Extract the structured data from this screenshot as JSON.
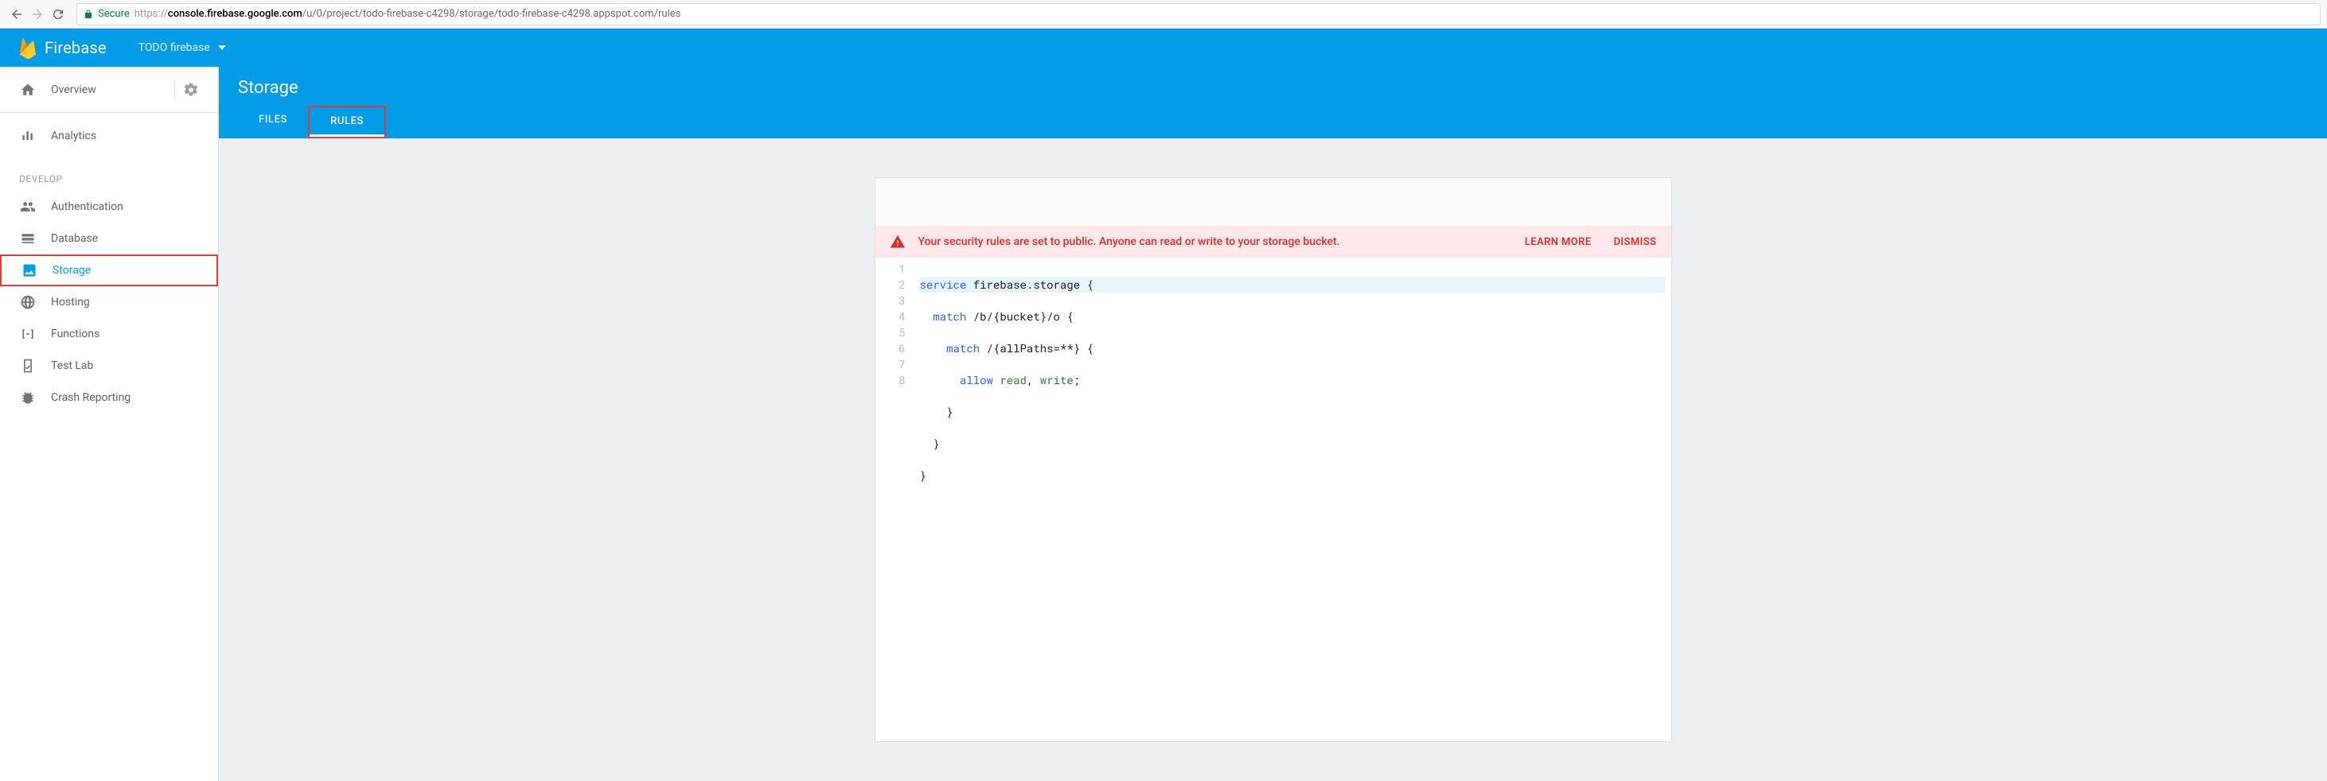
{
  "browser": {
    "secure_label": "Secure",
    "url_prefix": "https://",
    "url_host": "console.firebase.google.com",
    "url_path": "/u/0/project/todo-firebase-c4298/storage/todo-firebase-c4298.appspot.com/rules"
  },
  "app_bar": {
    "product": "Firebase",
    "project_name": "TODO firebase"
  },
  "sidebar": {
    "overview_label": "Overview",
    "analytics_label": "Analytics",
    "section_label": "DEVELOP",
    "items": [
      {
        "id": "authentication",
        "label": "Authentication"
      },
      {
        "id": "database",
        "label": "Database"
      },
      {
        "id": "storage",
        "label": "Storage"
      },
      {
        "id": "hosting",
        "label": "Hosting"
      },
      {
        "id": "functions",
        "label": "Functions"
      },
      {
        "id": "test-lab",
        "label": "Test Lab"
      },
      {
        "id": "crash-reporting",
        "label": "Crash Reporting"
      }
    ]
  },
  "main": {
    "title": "Storage",
    "tabs": {
      "files": "FILES",
      "rules": "RULES"
    },
    "alert": {
      "message": "Your security rules are set to public. Anyone can read or write to your storage bucket.",
      "learn_more": "LEARN MORE",
      "dismiss": "DISMISS"
    },
    "code": {
      "line_count": 8,
      "l1_kw": "service",
      "l1_rest": " firebase.storage {",
      "l2_kw": "match",
      "l2_rest": " /b/{bucket}/o {",
      "l3_kw": "match",
      "l3_rest": " /{allPaths=**} {",
      "l4_kw": "allow",
      "l4_p1": "read",
      "l4_comma": ", ",
      "l4_p2": "write",
      "l4_semi": ";",
      "l5": "    }",
      "l6": "  }",
      "l7": "}",
      "l8": ""
    }
  }
}
